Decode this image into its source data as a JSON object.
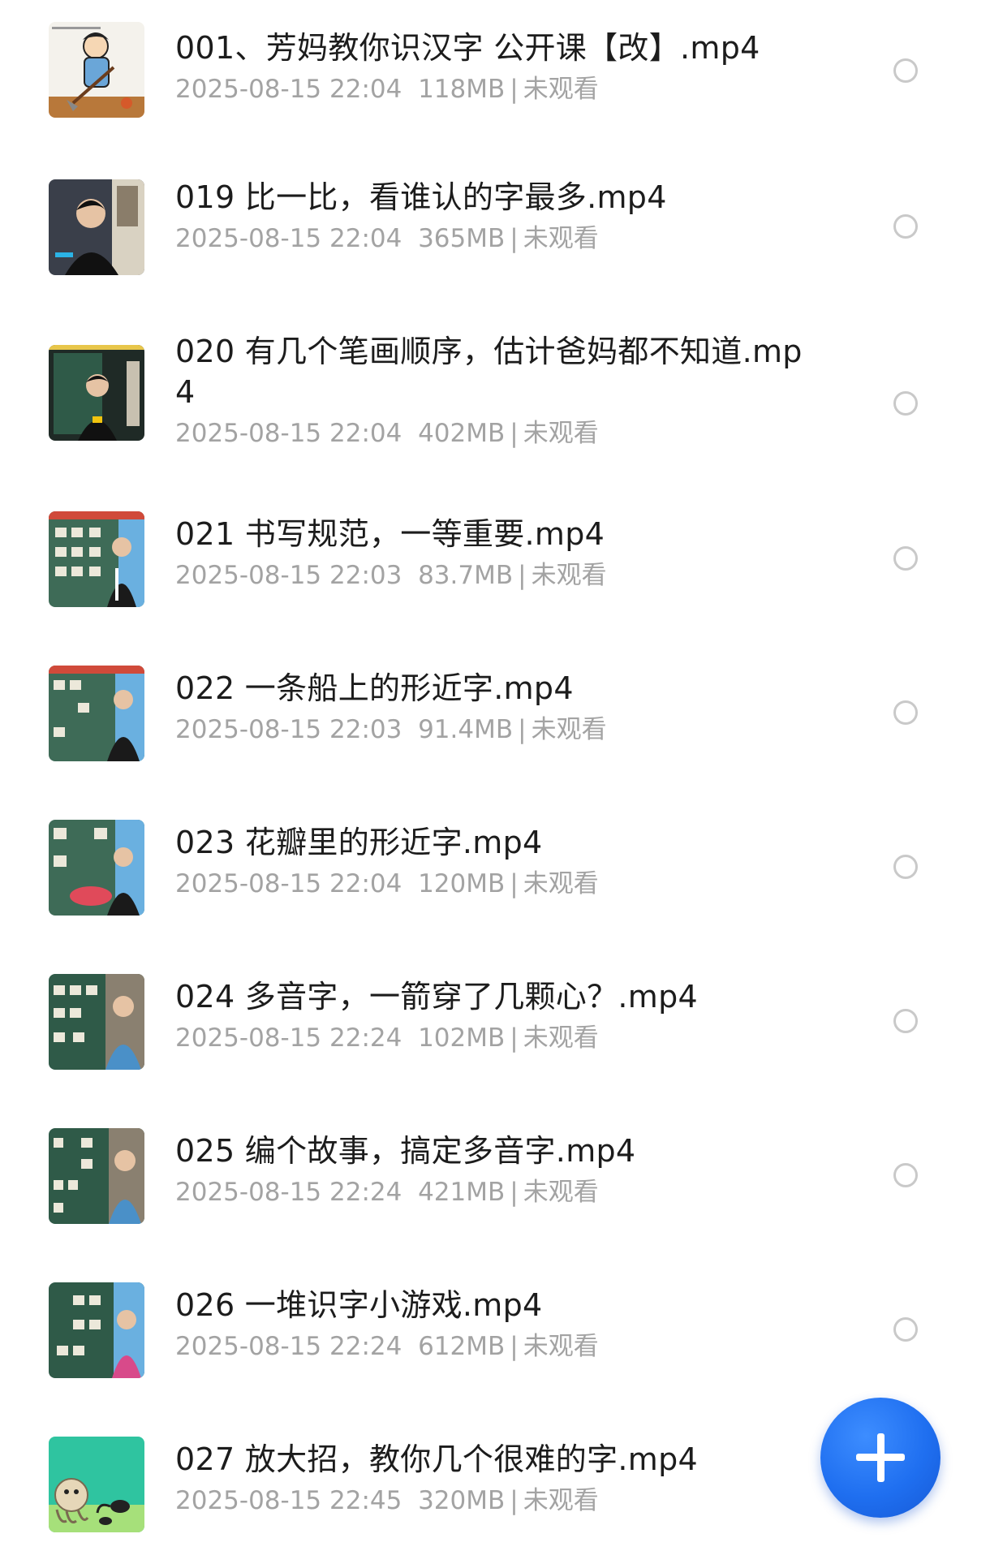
{
  "files": [
    {
      "title": "001、芳妈教你识汉字 公开课【改】.mp4",
      "date": "2025-08-15 22:04",
      "size": "118MB",
      "status": "未观看",
      "thumb": "cartoon"
    },
    {
      "title": "019 比一比，看谁认的字最多.mp4",
      "date": "2025-08-15 22:04",
      "size": "365MB",
      "status": "未观看",
      "thumb": "teacher-dark"
    },
    {
      "title": "020 有几个笔画顺序，估计爸妈都不知道.mp4",
      "date": "2025-08-15 22:04",
      "size": "402MB",
      "status": "未观看",
      "thumb": "teacher-board-dark"
    },
    {
      "title": "021 书写规范，一等重要.mp4",
      "date": "2025-08-15 22:03",
      "size": "83.7MB",
      "status": "未观看",
      "thumb": "teacher-board"
    },
    {
      "title": "022 一条船上的形近字.mp4",
      "date": "2025-08-15 22:03",
      "size": "91.4MB",
      "status": "未观看",
      "thumb": "teacher-board"
    },
    {
      "title": "023 花瓣里的形近字.mp4",
      "date": "2025-08-15 22:04",
      "size": "120MB",
      "status": "未观看",
      "thumb": "teacher-board-flower"
    },
    {
      "title": "024 多音字，一箭穿了几颗心？.mp4",
      "date": "2025-08-15 22:24",
      "size": "102MB",
      "status": "未观看",
      "thumb": "teacher-board-2"
    },
    {
      "title": "025 编个故事，搞定多音字.mp4",
      "date": "2025-08-15 22:24",
      "size": "421MB",
      "status": "未观看",
      "thumb": "teacher-board-2"
    },
    {
      "title": "026 一堆识字小游戏.mp4",
      "date": "2025-08-15 22:24",
      "size": "612MB",
      "status": "未观看",
      "thumb": "teacher-board-2"
    },
    {
      "title": "027 放大招，教你几个很难的字.mp4",
      "date": "2025-08-15 22:45",
      "size": "320MB",
      "status": "未观看",
      "thumb": "cartoon-green"
    }
  ],
  "fab": {
    "icon": "plus-icon"
  }
}
